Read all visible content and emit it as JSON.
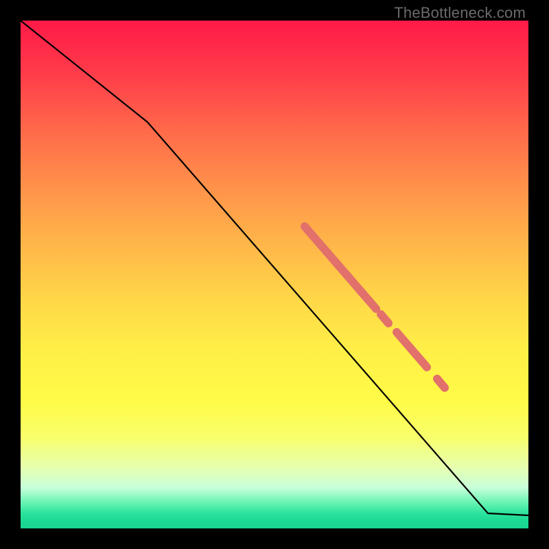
{
  "watermark": "TheBottleneck.com",
  "chart_data": {
    "type": "line",
    "title": "",
    "xlabel": "",
    "ylabel": "",
    "xlim": [
      0,
      100
    ],
    "ylim": [
      0,
      100
    ],
    "grid": false,
    "line": {
      "points": [
        {
          "x": 0,
          "y": 100
        },
        {
          "x": 25,
          "y": 80
        },
        {
          "x": 92,
          "y": 3
        },
        {
          "x": 100,
          "y": 2.5
        }
      ],
      "stroke": "#000000",
      "stroke_width": 2
    },
    "highlight_segments": [
      {
        "x_start": 56,
        "x_end": 70,
        "color": "#e2706b",
        "width": 12
      },
      {
        "x_start": 71,
        "x_end": 72.5,
        "color": "#e2706b",
        "width": 12
      },
      {
        "x_start": 74,
        "x_end": 80,
        "color": "#e2706b",
        "width": 12
      },
      {
        "x_start": 82,
        "x_end": 83.5,
        "color": "#e2706b",
        "width": 12
      }
    ]
  }
}
